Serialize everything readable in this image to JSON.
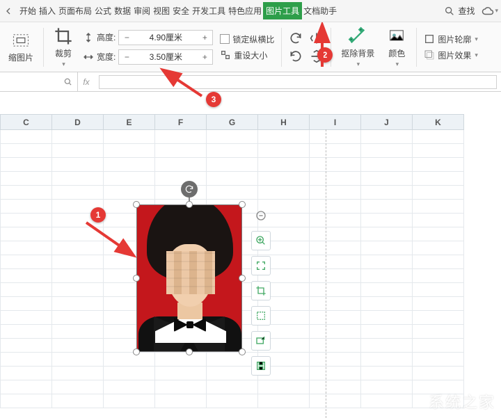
{
  "menu": {
    "items": [
      "开始",
      "插入",
      "页面布局",
      "公式",
      "数据",
      "审阅",
      "视图",
      "安全",
      "开发工具",
      "特色应用",
      "图片工具",
      "文档助手"
    ],
    "active": "图片工具",
    "search_label": "查找"
  },
  "ribbon": {
    "compress_label": "缩图片",
    "crop_label": "裁剪",
    "height_label": "高度:",
    "height_value": "4.90厘米",
    "width_label": "宽度:",
    "width_value": "3.50厘米",
    "lock_aspect_label": "锁定纵横比",
    "reset_size_label": "重设大小",
    "remove_bg_label": "抠除背景",
    "color_label": "颜色",
    "outline_label": "图片轮廓",
    "effects_label": "图片效果"
  },
  "callouts": {
    "n1": "1",
    "n2": "2",
    "n3": "3"
  },
  "columns": [
    "C",
    "D",
    "E",
    "F",
    "G",
    "H",
    "I",
    "J",
    "K"
  ],
  "watermark": "系统之家"
}
